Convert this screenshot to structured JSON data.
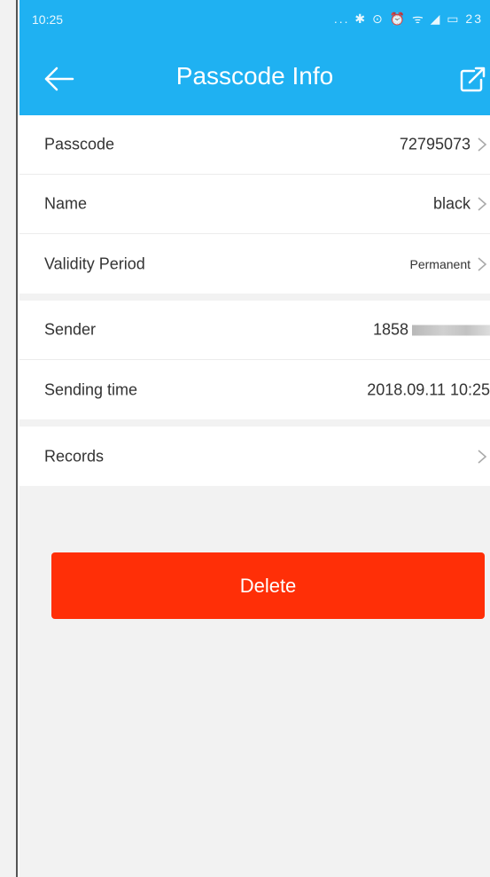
{
  "status_bar": {
    "time": "10:25",
    "icons": "... ✱ ⊙ ⏰ ᯤ ◢ ▭ 23"
  },
  "header": {
    "title": "Passcode Info",
    "back_icon": "back-arrow-icon",
    "edit_icon": "edit-share-icon"
  },
  "groups": [
    [
      {
        "label": "Passcode",
        "value": "72795073",
        "chevron": true
      },
      {
        "label": "Name",
        "value": "black",
        "chevron": true
      },
      {
        "label": "Validity Period",
        "value": "Permanent",
        "chevron": true
      }
    ],
    [
      {
        "label": "Sender",
        "value": "1858",
        "masked": true
      },
      {
        "label": "Sending time",
        "value": "2018.09.11 10:25"
      }
    ],
    [
      {
        "label": "Records",
        "value": "",
        "chevron": true
      }
    ]
  ],
  "delete_button": {
    "label": "Delete"
  },
  "colors": {
    "header": "#1fb1f2",
    "delete": "#ff2f07",
    "background": "#f2f2f2"
  }
}
